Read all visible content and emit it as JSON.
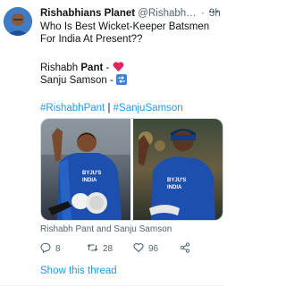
{
  "tweet": {
    "author_name": "Rishabhians Planet",
    "handle": "@Rishabh…",
    "separator": "·",
    "time": "3h",
    "lines": [
      "Who Is Best Wicket-Keeper Batsmen",
      "For India At Present??"
    ],
    "option1": {
      "prefix": "Rishabh ",
      "bold": "Pant",
      "suffix": " - "
    },
    "option2": {
      "text": "Sanju Samson - "
    },
    "hashtag1": "#RishabhPant",
    "hashtag_sep": " | ",
    "hashtag2": "#SanjuSamson",
    "media_caption": "Rishabh Pant and Sanju Samson",
    "jersey_text_1": "BYJU'S",
    "jersey_text_2": "INDIA",
    "replies": "8",
    "retweets": "28",
    "likes": "96",
    "show_thread": "Show this thread"
  },
  "colors": {
    "accent": "#1d9bf0",
    "text": "#0f1419",
    "muted": "#536471",
    "heart": "#e0245e",
    "repeat_emoji": "#3a86d6"
  },
  "icons": [
    "more-icon",
    "heart-emoji-icon",
    "repeat-emoji-icon",
    "reply-icon",
    "retweet-icon",
    "like-icon",
    "share-icon"
  ]
}
